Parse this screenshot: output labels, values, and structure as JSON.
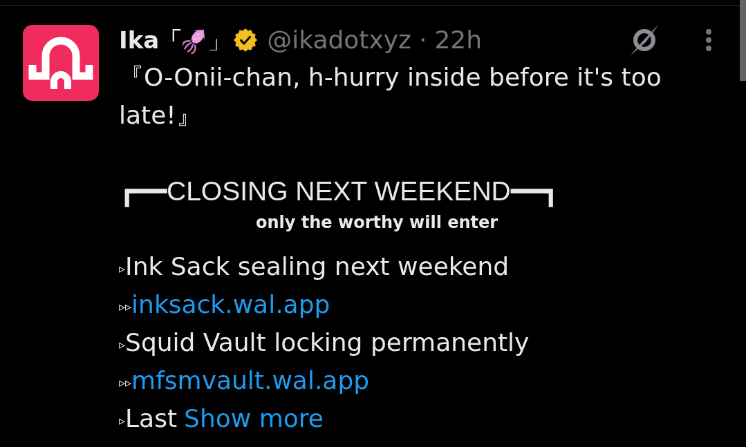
{
  "post": {
    "author": {
      "name": "Ika「",
      "name_end": "」",
      "verified": true,
      "handle": "@ikadotxyz",
      "separator": "·",
      "time": "22h"
    },
    "text": "『O-Onii-chan, h-hurry inside before it's too late!』",
    "banner": {
      "title": "┏━━CLOSING NEXT WEEKEND━━┓",
      "subtitle": "only the worthy will enter"
    },
    "lines": [
      {
        "kind": "text",
        "marker": "▹",
        "text": "Ink Sack sealing next weekend"
      },
      {
        "kind": "link",
        "marker": "▹▹",
        "text": "inksack.wal.app"
      },
      {
        "kind": "text",
        "marker": "▹",
        "text": "Squid Vault locking permanently"
      },
      {
        "kind": "link",
        "marker": "▹▹",
        "text": "mfsmvault.wal.app"
      },
      {
        "kind": "teaser",
        "marker": "▹",
        "text": "Last",
        "more": "Show more"
      }
    ]
  }
}
